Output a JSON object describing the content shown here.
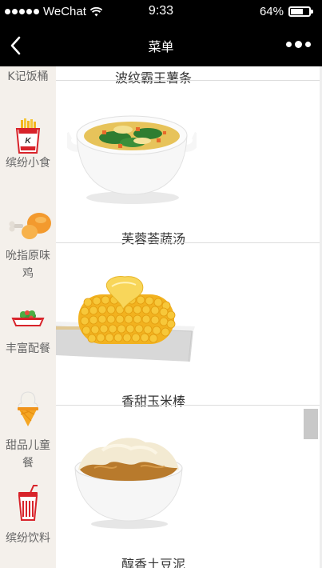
{
  "status_bar": {
    "carrier": "WeChat",
    "time": "9:33",
    "battery": "64%",
    "battery_level": 0.64,
    "signal_icon": "signal-dots-icon",
    "wifi_icon": "wifi-icon"
  },
  "nav": {
    "title": "菜单",
    "back_icon": "chevron-left-icon",
    "more_icon": "more-dots-icon"
  },
  "sidebar": {
    "items": [
      {
        "label": "K记饭桶",
        "icon": ""
      },
      {
        "label": "缤纷小食",
        "icon": "fries-bucket-icon"
      },
      {
        "label": "吮指原味鸡",
        "icon": "chicken-drumstick-icon"
      },
      {
        "label": "丰富配餐",
        "icon": "side-dish-icon"
      },
      {
        "label": "甜品儿童餐",
        "icon": "ice-cream-cone-icon"
      },
      {
        "label": "缤纷饮料",
        "icon": "drink-cup-icon"
      }
    ]
  },
  "menu": {
    "items": [
      {
        "name": "波纹霸王薯条"
      },
      {
        "name": "芙蓉荟蔬汤",
        "image": "vegetable-soup-bowl"
      },
      {
        "name": "香甜玉米棒",
        "image": "corn-on-cob-plate"
      },
      {
        "name": "醇香土豆泥",
        "image": "mashed-potato-bowl"
      }
    ]
  }
}
